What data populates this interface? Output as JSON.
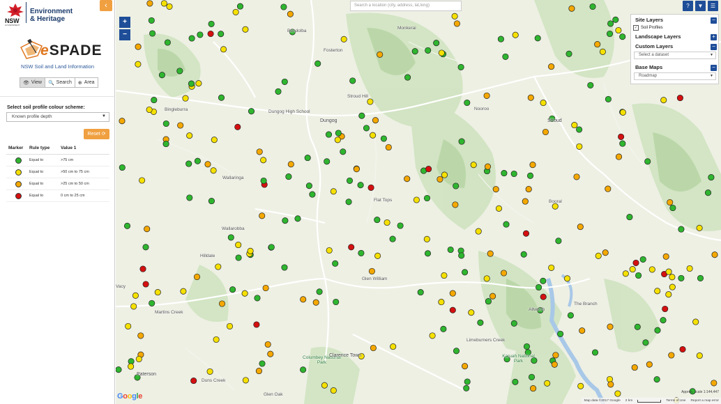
{
  "header": {
    "gov_label": "NSW",
    "gov_sub": "GOVERNMENT",
    "dept_line1": "Environment",
    "dept_line2": "& Heritage",
    "collapse_icon": "chevron-left-icon"
  },
  "app": {
    "logo_prefix": "e",
    "logo_text": "SPADE",
    "tagline": "NSW Soil and Land Information"
  },
  "tabs": [
    {
      "label": "View",
      "icon": "eye-icon",
      "glyph": "👁",
      "active": true
    },
    {
      "label": "Search",
      "icon": "search-icon",
      "glyph": "🔍",
      "active": false
    },
    {
      "label": "Area",
      "icon": "area-icon",
      "glyph": "⊕",
      "active": false
    }
  ],
  "scheme": {
    "label": "Select soil profile colour scheme:",
    "selected": "Known profile depth"
  },
  "reset_label": "Reset",
  "legend": {
    "headers": [
      "Marker",
      "Rule type",
      "Value 1"
    ],
    "rows": [
      {
        "color": "#2fb52f",
        "rule": "Equal to",
        "value": ">75 cm"
      },
      {
        "color": "#f5e000",
        "rule": "Equal to",
        "value": ">50 cm to 75 cm"
      },
      {
        "color": "#f4a800",
        "rule": "Equal to",
        "value": ">25 cm to 50 cm"
      },
      {
        "color": "#d41010",
        "rule": "Equal to",
        "value": "0 cm to 25 cm"
      }
    ]
  },
  "map": {
    "search_placeholder": "Search a location (city, address, lat,long)",
    "zoom_in": "+",
    "zoom_out": "−",
    "top_buttons": [
      {
        "icon": "help-icon",
        "glyph": "?"
      },
      {
        "icon": "comment-icon",
        "glyph": "▼"
      },
      {
        "icon": "menu-icon",
        "glyph": "☰"
      }
    ],
    "layers": {
      "site_layers": "Site Layers",
      "soil_profiles": "Soil Profiles",
      "landscape_layers": "Landscape Layers",
      "custom_layers": "Custom Layers",
      "select_dataset": "Select a dataset",
      "base_maps": "Base Maps",
      "base_map_selected": "Roadmap"
    },
    "places": [
      "Bendolba",
      "Fosterton",
      "Monkerai",
      "Bingleburra",
      "Stroud Hill",
      "Dungog High School",
      "Dungog",
      "Nooroo",
      "Stroud",
      "Wallarobba",
      "Flat Tops",
      "Booral",
      "Wallaringa",
      "Hilldale",
      "Glen William",
      "Allworth",
      "The Branch",
      "Martins Creek",
      "Paterson",
      "Limeburners Creek",
      "Columbey National Park",
      "Clarence Town",
      "Karuah National Park",
      "Duns Creek",
      "Glen Oak",
      "Vacy"
    ],
    "attribution": {
      "map_data": "Map data ©2017 Google",
      "scale": "2 km",
      "terms": "Terms of Use",
      "report": "Report a map error",
      "approx": "Approx. scale 1:144,447"
    },
    "google": "Google"
  },
  "colors": {
    "green": "#2fb52f",
    "yellow": "#f5e000",
    "orange": "#f4a800",
    "red": "#d41010",
    "accent": "#f0a040",
    "control_blue": "#1f4e99"
  }
}
